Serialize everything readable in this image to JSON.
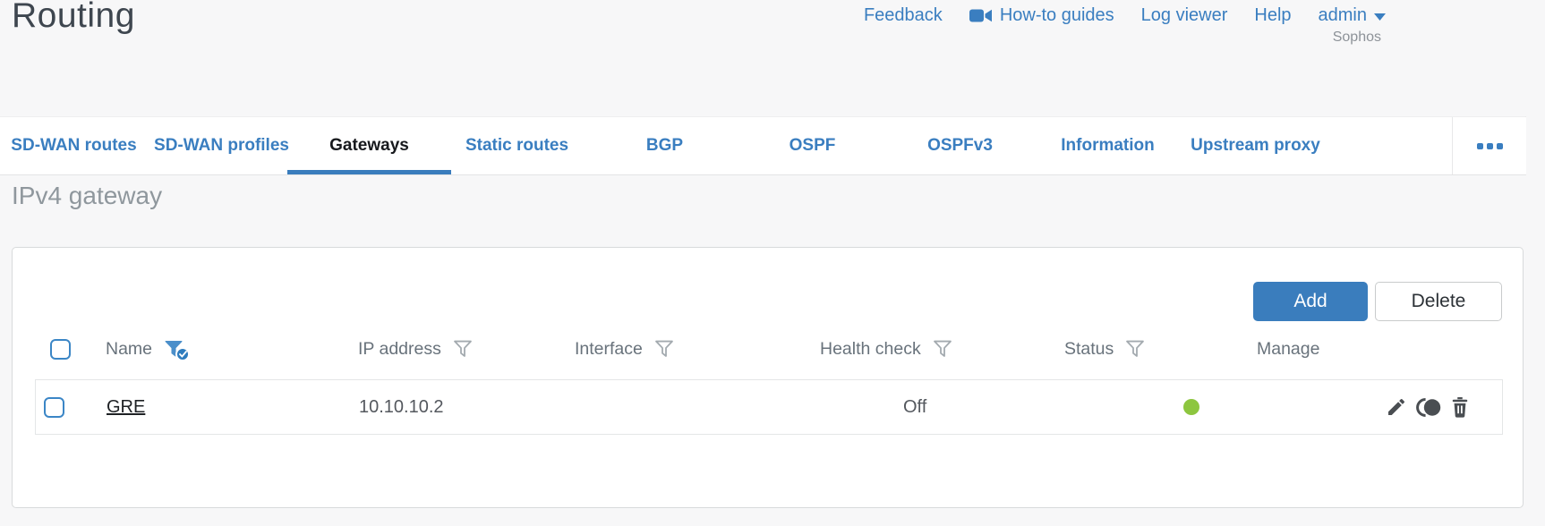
{
  "header": {
    "title": "Routing",
    "links": {
      "feedback": "Feedback",
      "how_to_guides": "How-to guides",
      "log_viewer": "Log viewer",
      "help": "Help",
      "user": "admin"
    },
    "brand": "Sophos"
  },
  "tabs": [
    {
      "label": "SD-WAN routes",
      "active": false
    },
    {
      "label": "SD-WAN profiles",
      "active": false
    },
    {
      "label": "Gateways",
      "active": true
    },
    {
      "label": "Static routes",
      "active": false
    },
    {
      "label": "BGP",
      "active": false
    },
    {
      "label": "OSPF",
      "active": false
    },
    {
      "label": "OSPFv3",
      "active": false
    },
    {
      "label": "Information",
      "active": false
    },
    {
      "label": "Upstream proxy",
      "active": false
    }
  ],
  "section": {
    "heading": "IPv4 gateway"
  },
  "toolbar": {
    "add": "Add",
    "delete": "Delete"
  },
  "table": {
    "columns": [
      {
        "label": "Name",
        "filter": "active"
      },
      {
        "label": "IP address",
        "filter": "inactive"
      },
      {
        "label": "Interface",
        "filter": "inactive"
      },
      {
        "label": "Health check",
        "filter": "inactive"
      },
      {
        "label": "Status",
        "filter": "inactive"
      },
      {
        "label": "Manage",
        "filter": "none"
      }
    ],
    "rows": [
      {
        "name": "GRE",
        "ip_address": "10.10.10.2",
        "interface": "",
        "health_check": "Off",
        "status": "up",
        "manage_icons": [
          "edit",
          "clone",
          "delete"
        ]
      }
    ]
  },
  "colors": {
    "accent": "#3a7ec0",
    "status_up": "#8dc63f"
  }
}
